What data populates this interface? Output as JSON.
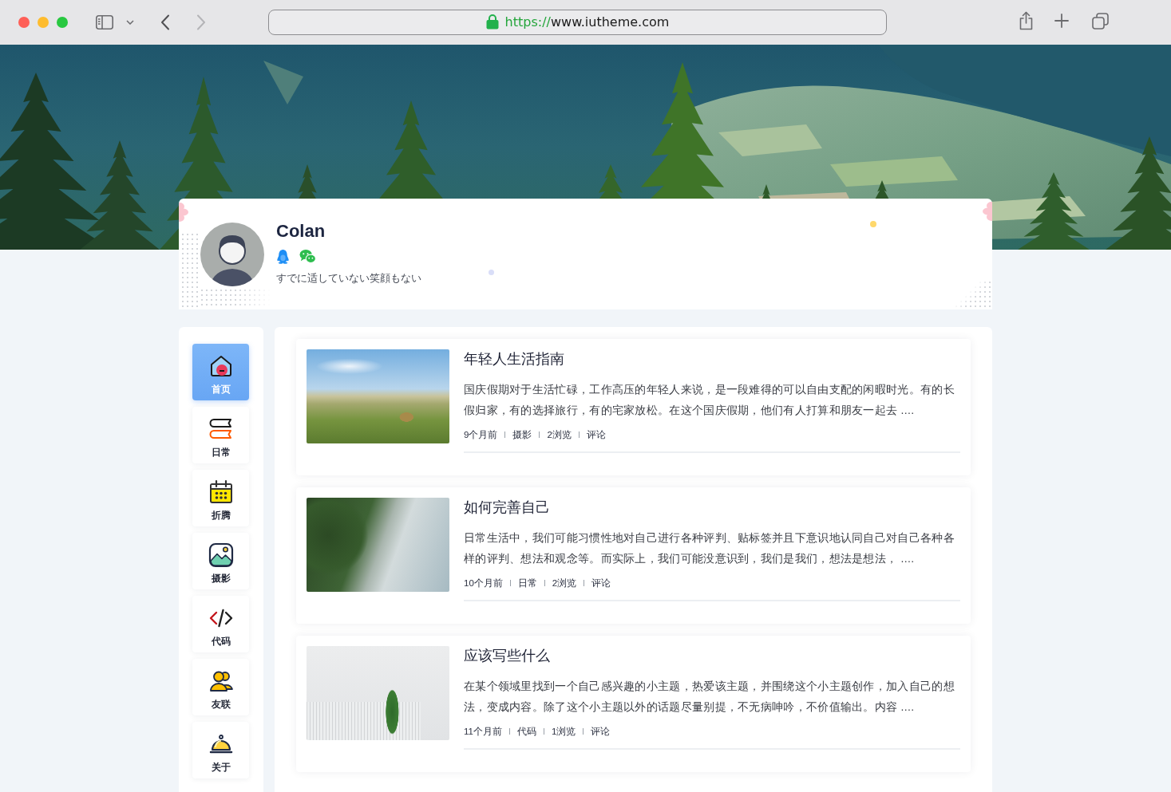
{
  "browser": {
    "back_disabled": false,
    "forward_disabled": true,
    "url_scheme": "https://",
    "url_host": "www.iutheme.com"
  },
  "profile": {
    "name": "Colan",
    "bio": "すでに适していない笑顔もない"
  },
  "nav": [
    {
      "label": "首页",
      "selected": true
    },
    {
      "label": "日常",
      "selected": false
    },
    {
      "label": "折腾",
      "selected": false
    },
    {
      "label": "摄影",
      "selected": false
    },
    {
      "label": "代码",
      "selected": false
    },
    {
      "label": "友联",
      "selected": false
    },
    {
      "label": "关于",
      "selected": false
    }
  ],
  "posts": [
    {
      "title": "年轻人生活指南",
      "excerpt": "国庆假期对于生活忙碌，工作高压的年轻人来说，是一段难得的可以自由支配的闲暇时光。有的长假归家，有的选择旅行，有的宅家放松。在这个国庆假期，他们有人打算和朋友一起去 ....",
      "meta": {
        "time": "9个月前",
        "category": "摄影",
        "views": "2浏览",
        "comments": "评论"
      }
    },
    {
      "title": "如何完善自己",
      "excerpt": "日常生活中，我们可能习惯性地对自己进行各种评判、贴标签并且下意识地认同自己对自己各种各样的评判、想法和观念等。而实际上，我们可能没意识到，我们是我们，想法是想法， ....",
      "meta": {
        "time": "10个月前",
        "category": "日常",
        "views": "2浏览",
        "comments": "评论"
      }
    },
    {
      "title": "应该写些什么",
      "excerpt": "在某个领域里找到一个自己感兴趣的小主题，热爱该主题，并围绕这个小主题创作，加入自己的想法，变成内容。除了这个小主题以外的话题尽量别提，不无病呻吟，不价值输出。内容 ....",
      "meta": {
        "time": "11个月前",
        "category": "代码",
        "views": "1浏览",
        "comments": "评论"
      }
    }
  ]
}
